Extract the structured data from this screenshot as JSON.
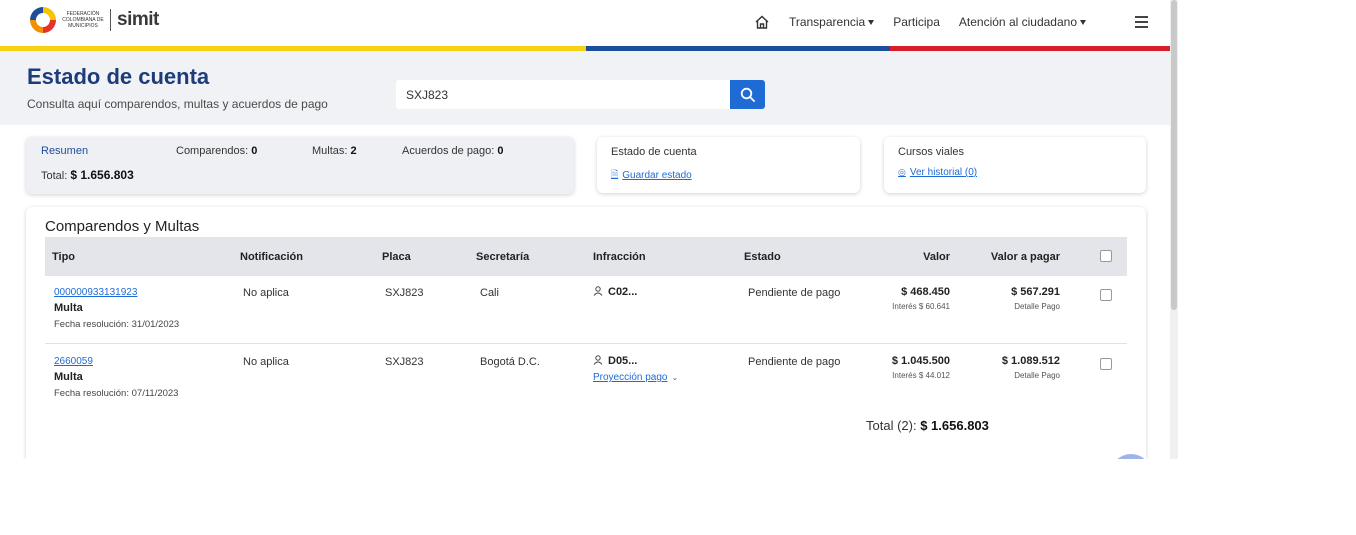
{
  "header": {
    "logo_text": "Federación Colombiana de Municipios",
    "brand": "simit",
    "nav": [
      {
        "label": "Transparencia",
        "dropdown": true
      },
      {
        "label": "Participa",
        "dropdown": false
      },
      {
        "label": "Atención al ciudadano",
        "dropdown": true
      }
    ],
    "stripe_colors": [
      "#f7d117",
      "#1d4e9b",
      "#d81e2b"
    ]
  },
  "page": {
    "title": "Estado de cuenta",
    "subtitle": "Consulta aquí comparendos, multas y acuerdos de pago"
  },
  "search": {
    "value": "SXJ823"
  },
  "summary": {
    "label": "Resumen",
    "comparendos_label": "Comparendos:",
    "comparendos_value": "0",
    "multas_label": "Multas:",
    "multas_value": "2",
    "acuerdos_label": "Acuerdos de pago:",
    "acuerdos_value": "0",
    "total_label": "Total:",
    "total_value": "$ 1.656.803"
  },
  "estado_card": {
    "title": "Estado de cuenta",
    "link": "Guardar estado"
  },
  "cursos_card": {
    "title": "Cursos viales",
    "link": "Ver historial (0)"
  },
  "table": {
    "title": "Comparendos y Multas",
    "headers": [
      "Tipo",
      "Notificación",
      "Placa",
      "Secretaría",
      "Infracción",
      "Estado",
      "Valor",
      "Valor a pagar"
    ],
    "rows": [
      {
        "numero": "000000933131923",
        "tipo": "Multa",
        "fecha": "Fecha resolución: 31/01/2023",
        "notificacion": "No aplica",
        "placa": "SXJ823",
        "secretaria": "Cali",
        "infraccion": "C02...",
        "estado": "Pendiente de pago",
        "valor": "$ 468.450",
        "interes": "Interés $ 60.641",
        "valor_pagar": "$ 567.291",
        "detalle": "Detalle Pago"
      },
      {
        "numero": "2660059",
        "tipo": "Multa",
        "fecha": "Fecha resolución: 07/11/2023",
        "notificacion": "No aplica",
        "placa": "SXJ823",
        "secretaria": "Bogotá D.C.",
        "infraccion": "D05...",
        "proyeccion": "Proyección pago",
        "estado": "Pendiente de pago",
        "valor": "$ 1.045.500",
        "interes": "Interés $ 44.012",
        "valor_pagar": "$ 1.089.512",
        "detalle": "Detalle Pago"
      }
    ],
    "total_label": "Total (2):",
    "total_value": "$ 1.656.803"
  },
  "colors": {
    "primary": "#1f6bd6",
    "title": "#1d3d7a"
  }
}
